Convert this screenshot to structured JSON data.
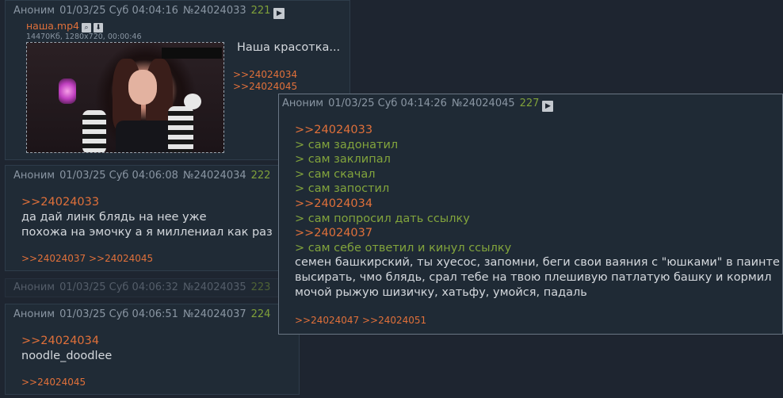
{
  "posts": [
    {
      "header": {
        "name": "Аноним",
        "date": "01/03/25 Суб 04:04:16",
        "number": "№24024033",
        "index": "221"
      },
      "file": {
        "name": "наша.mp4",
        "meta": "14470Кб, 1280x720, 00:00:46"
      },
      "body": [
        "Наша красотка..."
      ],
      "replies": [
        ">>24024034",
        ">>24024045"
      ]
    },
    {
      "header": {
        "name": "Аноним",
        "date": "01/03/25 Суб 04:06:08",
        "number": "№24024034",
        "index": "222"
      },
      "quote": ">>24024033",
      "body": [
        "да дай линк блядь на нее уже",
        "похожа на эмочку а я миллениал как раз"
      ],
      "replies": ">>24024037 >>24024045"
    },
    {
      "header": {
        "name": "Аноним",
        "date": "01/03/25 Суб 04:06:32",
        "number": "№24024035",
        "index": "223"
      }
    },
    {
      "header": {
        "name": "Аноним",
        "date": "01/03/25 Суб 04:06:51",
        "number": "№24024037",
        "index": "224"
      },
      "quote": ">>24024034",
      "body": [
        "noodle_doodlee"
      ],
      "replies": ">>24024045"
    }
  ],
  "popup": {
    "header": {
      "name": "Аноним",
      "date": "01/03/25 Суб 04:14:26",
      "number": "№24024045",
      "index": "227"
    },
    "lines": [
      {
        "text": ">>24024033",
        "kind": "reply"
      },
      {
        "text": "> сам задонатил",
        "kind": "gt"
      },
      {
        "text": "> сам заклипал",
        "kind": "gt"
      },
      {
        "text": "> сам скачал",
        "kind": "gt"
      },
      {
        "text": "> сам запостил",
        "kind": "gt"
      },
      {
        "text": ">>24024034",
        "kind": "reply"
      },
      {
        "text": "> сам попросил дать ссылку",
        "kind": "gt"
      },
      {
        "text": ">>24024037",
        "kind": "reply"
      },
      {
        "text": "> сам себе ответил и кинул ссылку",
        "kind": "gt"
      },
      {
        "text": "семен башкирский, ты хуесос, запомни, беги свои ваяния с \"юшками\" в паинте",
        "kind": "text"
      },
      {
        "text": "высирать, чмо блядь, срал тебе на твою плешивую патлатую башку и кормил",
        "kind": "text"
      },
      {
        "text": "мочой рыжую шизичку, хатьфу, умойся, падаль",
        "kind": "text"
      }
    ],
    "replies": ">>24024047 >>24024051"
  },
  "icons": {
    "play": "play-icon",
    "search": "search-icon",
    "download": "download-icon"
  },
  "colors": {
    "reply": "#e0703a",
    "greentext": "#82a43c",
    "header": "#8a96a3",
    "background": "#1e2530",
    "post": "#202b36"
  }
}
